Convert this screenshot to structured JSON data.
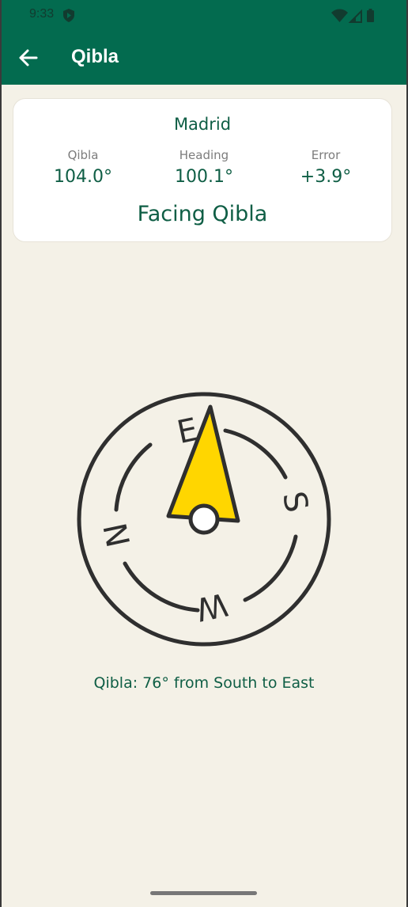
{
  "status_bar": {
    "time": "9:33",
    "icons": [
      "shield-icon",
      "wifi-icon",
      "signal-icon",
      "battery-icon"
    ]
  },
  "app_bar": {
    "title": "Qibla",
    "back_icon": "arrow-left-icon",
    "color": "#036b4f"
  },
  "summary": {
    "city": "Madrid",
    "stats": [
      {
        "label": "Qibla",
        "value": "104.0°"
      },
      {
        "label": "Heading",
        "value": "100.1°"
      },
      {
        "label": "Error",
        "value": "+3.9°"
      }
    ],
    "status": "Facing Qibla"
  },
  "compass": {
    "labels": {
      "north": "N",
      "east": "E",
      "south": "S",
      "west": "W"
    },
    "needle_color": "#ffd600"
  },
  "qibla_direction_text": "Qibla: 76° from South to East",
  "colors": {
    "background": "#f4f1e7",
    "accent": "#0f5e45",
    "card": "#ffffff"
  }
}
